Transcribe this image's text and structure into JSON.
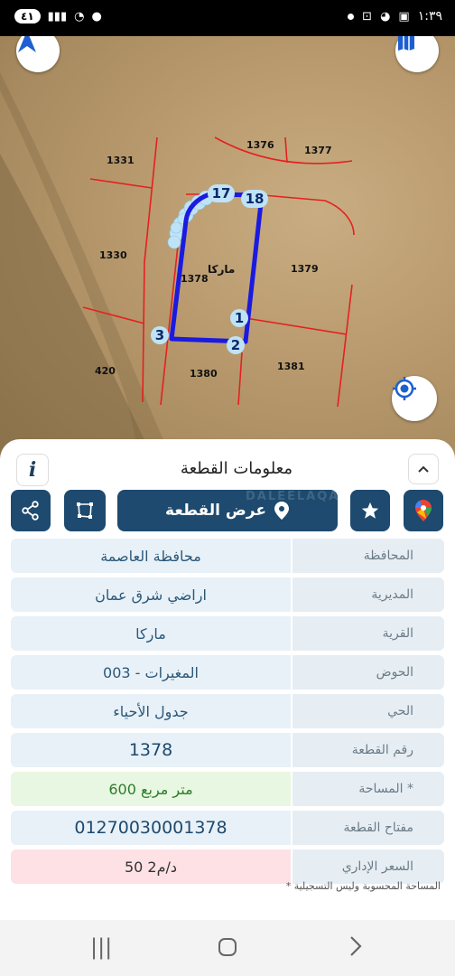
{
  "status_bar": {
    "battery": "٤١",
    "time": "١:٣٩"
  },
  "map": {
    "parcel_numbers": [
      "1331",
      "1376",
      "1377",
      "1330",
      "1378",
      "1379",
      "420",
      "1380",
      "1381"
    ],
    "area_name": "ماركا",
    "vertices": [
      "17",
      "18",
      "1",
      "2",
      "3"
    ],
    "icons": {
      "north_arrow": "north-arrow-icon",
      "layers": "layers-icon",
      "locate": "my-location-icon"
    }
  },
  "sheet": {
    "title": "معلومات القطعة",
    "watermark": "DALEELAQAR",
    "view_parcel_label": "عرض القطعة",
    "rows": [
      {
        "label": "المحافظة",
        "value": "محافظة العاصمة"
      },
      {
        "label": "المديرية",
        "value": "اراضي شرق عمان"
      },
      {
        "label": "القرية",
        "value": "ماركا"
      },
      {
        "label": "الحوض",
        "value": "المغيرات - 003"
      },
      {
        "label": "الحي",
        "value": "جدول الأحياء"
      },
      {
        "label": "رقم القطعة",
        "value": "1378"
      },
      {
        "label": "المساحة *",
        "value": "600  متر مربع"
      },
      {
        "label": "مفتاح القطعة",
        "value": "01270030001378"
      },
      {
        "label": "السعر الإداري",
        "value": "50 د/م2"
      }
    ],
    "footnote": "* المساحة المحسوبة وليس التسجيلية"
  },
  "colors": {
    "primary": "#1d4a6e",
    "parcel_line": "#e52020",
    "selected_parcel": "#1a1ae0"
  }
}
